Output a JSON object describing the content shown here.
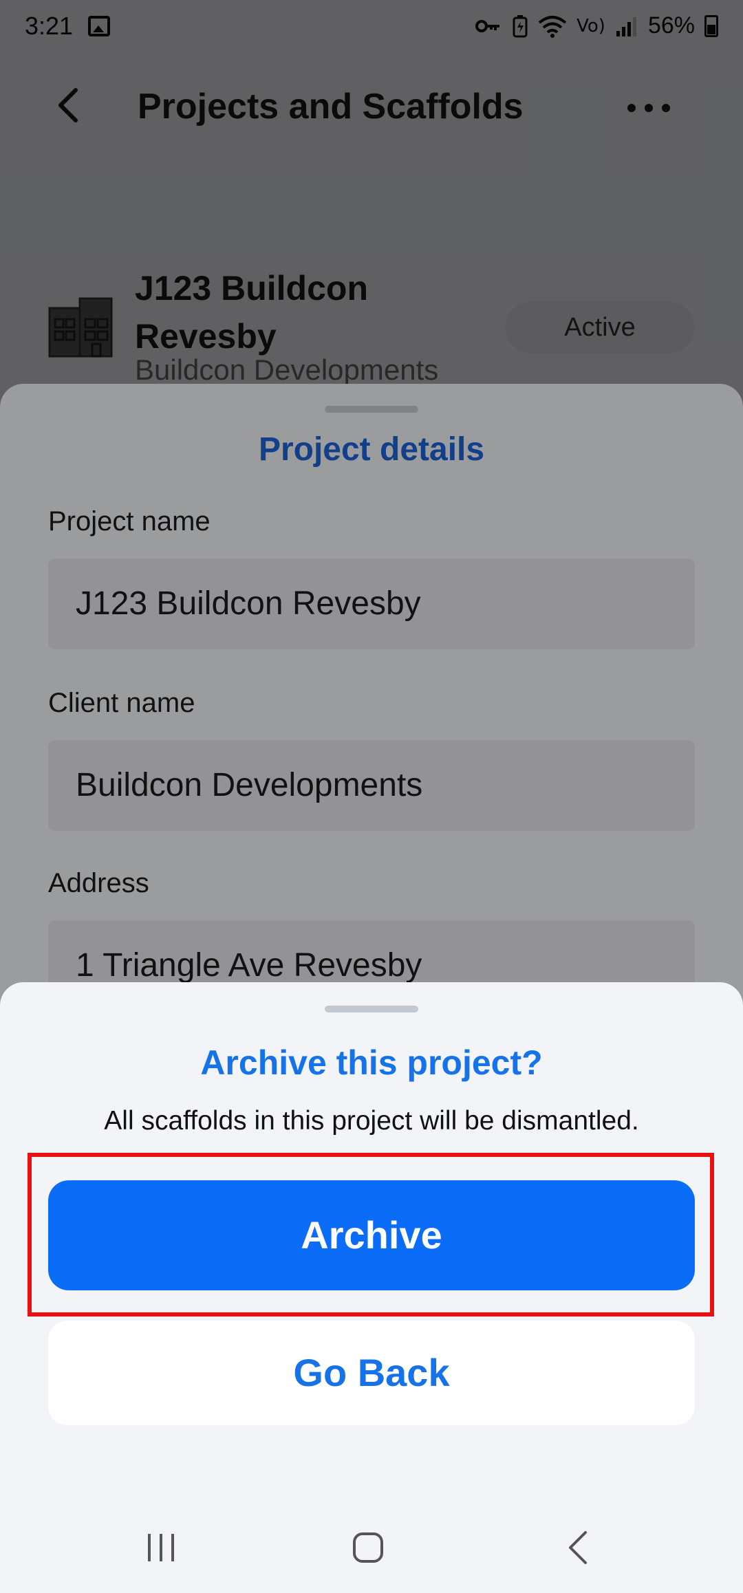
{
  "status_bar": {
    "time": "3:21",
    "battery": "56%",
    "icons": [
      "image-icon",
      "key-icon",
      "battery-saver-icon",
      "wifi-icon",
      "volte-icon",
      "signal-icon",
      "battery-icon"
    ]
  },
  "header": {
    "title": "Projects and Scaffolds",
    "back_icon": "chevron-left-icon",
    "more_icon": "more-horizontal-icon"
  },
  "project": {
    "name": "J123 Buildcon Revesby",
    "client": "Buildcon Developments",
    "status": "Active",
    "icon": "building-icon"
  },
  "details_sheet": {
    "title": "Project details",
    "fields": [
      {
        "label": "Project name",
        "value": "J123 Buildcon Revesby"
      },
      {
        "label": "Client name",
        "value": "Buildcon Developments"
      },
      {
        "label": "Address",
        "value": "1 Triangle Ave Revesby"
      }
    ]
  },
  "archive_dialog": {
    "title": "Archive this project?",
    "message": "All scaffolds in this project will be dismantled.",
    "confirm_label": "Archive",
    "cancel_label": "Go Back"
  },
  "colors": {
    "primary_blue": "#0a6cf7",
    "title_blue": "#1572e8",
    "highlight_red": "#e81010"
  },
  "nav_bar": {
    "icons": [
      "recent-apps-icon",
      "home-icon",
      "back-icon"
    ]
  }
}
